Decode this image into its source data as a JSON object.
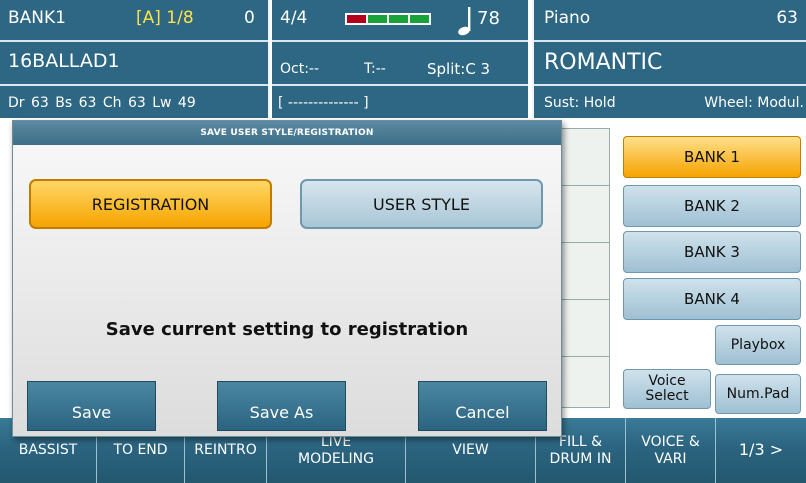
{
  "header": {
    "left": {
      "bank": "BANK1",
      "variation": "[A] 1/8",
      "counter": "0",
      "style_name": "16BALLAD1",
      "volumes": "Dr 63  Bs 63  Ch 63  Lw 49"
    },
    "middle": {
      "time_signature": "4/4",
      "tempo": "78",
      "octave": "Oct:--",
      "transpose": "T:--",
      "split": "Split:C 3",
      "lyrics_field": "[ -------------- ]",
      "meter_colors": [
        "#b3001b",
        "#17a33a",
        "#17a33a",
        "#17a33a"
      ]
    },
    "right": {
      "instrument": "Piano",
      "instrument_number": "63",
      "voice_name": "ROMANTIC",
      "sustain": "Sust: Hold",
      "wheel": "Wheel: Modul."
    }
  },
  "dialog": {
    "title": "SAVE USER STYLE/REGISTRATION",
    "registration_label": "REGISTRATION",
    "user_style_label": "USER STYLE",
    "message": "Save current setting to registration",
    "save_label": "Save",
    "save_as_label": "Save As",
    "cancel_label": "Cancel"
  },
  "banks": [
    "BANK 1",
    "BANK 2",
    "BANK 3",
    "BANK 4"
  ],
  "side_buttons": {
    "playbox": "Playbox",
    "voice_select_line1": "Voice",
    "voice_select_line2": "Select",
    "num_pad": "Num.Pad"
  },
  "bottom_tabs": {
    "bassist": "BASSIST",
    "to_end": "TO END",
    "reintro": "REINTRO",
    "live_line1": "LIVE",
    "live_line2": "MODELING",
    "view": "VIEW",
    "fill_line1": "FILL &",
    "fill_line2": "DRUM IN",
    "voice_line1": "VOICE &",
    "voice_line2": "VARI",
    "page": "1/3 >"
  },
  "colors": {
    "header_bg": "#2d6783",
    "highlight_yellow": "#ffe14a",
    "active_orange": "#f5a300"
  }
}
